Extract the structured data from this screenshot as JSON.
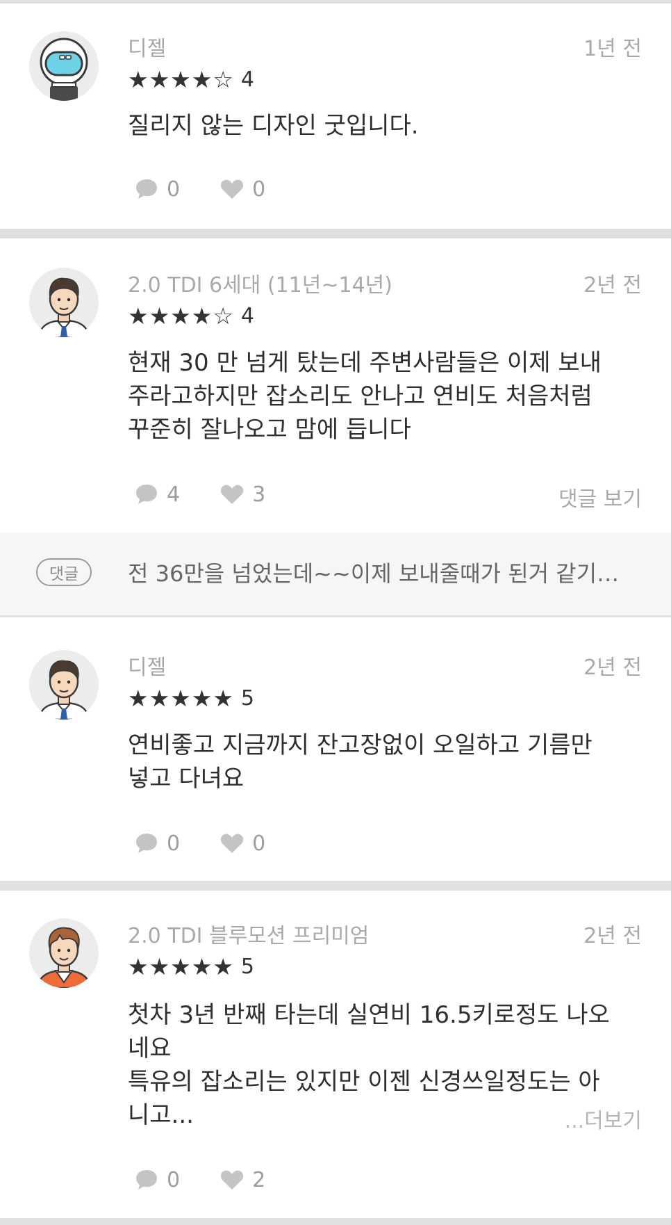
{
  "reviews": [
    {
      "author": "디젤",
      "time": "1년 전",
      "stars": "★★★★☆",
      "rating": "4",
      "text": "질리지 않는 디자인 굿입니다.",
      "comment_count": "0",
      "like_count": "0",
      "avatar": "astronaut-avatar"
    },
    {
      "author": "2.0 TDI 6세대 (11년~14년)",
      "time": "2년 전",
      "stars": "★★★★☆",
      "rating": "4",
      "text": "현재 30 만 넘게 탔는데 주변사람들은 이제 보내\n주라고하지만 잡소리도 안나고 연비도 처음처럼\n꾸준히 잘나오고 맘에 듭니다",
      "comment_count": "4",
      "like_count": "3",
      "view_comments_label": "댓글 보기",
      "avatar": "businessman-avatar",
      "reply": {
        "badge": "댓글",
        "text": "전 36만을 넘었는데~~이제 보내줄때가 된거 같기…"
      }
    },
    {
      "author": "디젤",
      "time": "2년 전",
      "stars": "★★★★★",
      "rating": "5",
      "text": "연비좋고 지금까지 잔고장없이 오일하고 기름만\n넣고 다녀요",
      "comment_count": "0",
      "like_count": "0",
      "avatar": "businessman-avatar"
    },
    {
      "author": "2.0 TDI 블루모션 프리미엄",
      "time": "2년 전",
      "stars": "★★★★★",
      "rating": "5",
      "text": "첫차 3년 반째 타는데 실연비 16.5키로정도 나오\n네요\n특유의 잡소리는 있지만 이젠 신경쓰일정도는 아\n니고...",
      "more_label": "...더보기",
      "comment_count": "0",
      "like_count": "2",
      "avatar": "young-man-avatar"
    }
  ],
  "icons": {
    "comment": "speech-bubble-icon",
    "like": "heart-icon"
  },
  "colors": {
    "icon": "#c4c4c4",
    "meta_text": "#a9a9a9",
    "body_text": "#2e2e2e"
  }
}
